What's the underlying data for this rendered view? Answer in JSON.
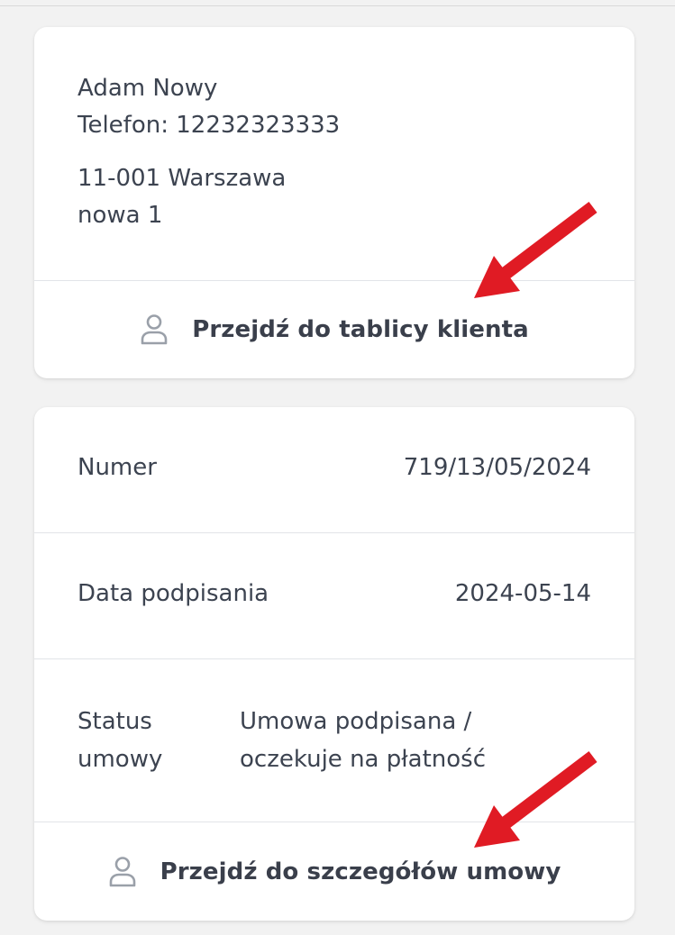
{
  "client": {
    "name": "Adam Nowy",
    "phone": "Telefon: 12232323333",
    "city": "11-001 Warszawa",
    "street": "nowa 1",
    "action_label": "Przejdź do tablicy klienta"
  },
  "contract": {
    "rows": [
      {
        "label": "Numer",
        "value": "719/13/05/2024"
      },
      {
        "label": "Data podpisania",
        "value": "2024-05-14"
      }
    ],
    "status": {
      "label_line1": "Status",
      "label_line2": "umowy",
      "value_line1": "Umowa podpisana /",
      "value_line2": "oczekuje na płatność"
    },
    "action_label": "Przejdź do szczegółów umowy"
  },
  "colors": {
    "background": "#f2f2f2",
    "card": "#ffffff",
    "text": "#3c4350",
    "annotation_arrow": "#e01b24",
    "icon": "#9aa0a9"
  },
  "icons": {
    "client_action": "person-icon",
    "contract_action": "person-icon",
    "annotation": "red-arrow"
  }
}
